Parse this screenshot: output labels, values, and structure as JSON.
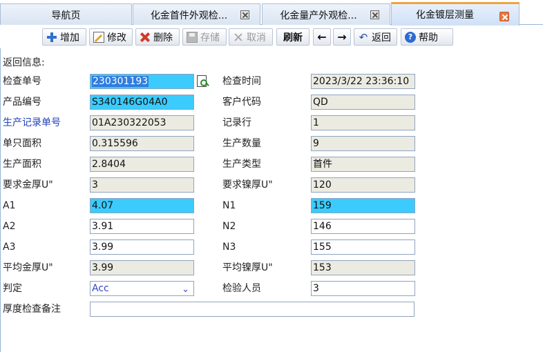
{
  "tabs": [
    {
      "label": "导航页"
    },
    {
      "label": "化金首件外观检..."
    },
    {
      "label": "化金量产外观检..."
    },
    {
      "label": "化金镀层测量"
    }
  ],
  "toolbar": {
    "add": "增加",
    "edit": "修改",
    "delete": "删除",
    "save": "存储",
    "cancel": "取消",
    "refresh": "刷新",
    "prev": "←",
    "next": "→",
    "back": "返回",
    "help": "帮助",
    "help_icon_glyph": "?",
    "back_icon_glyph": "↶"
  },
  "form": {
    "return_info_label": "返回信息:",
    "inspection_no": {
      "label": "检查单号",
      "value": "230301193"
    },
    "inspection_time": {
      "label": "检查时间",
      "value": "2023/3/22 23:36:10"
    },
    "product_no": {
      "label": "产品编号",
      "value": "S340146G04A0"
    },
    "customer_code": {
      "label": "客户代码",
      "value": "QD"
    },
    "production_record_no": {
      "label": "生产记录单号",
      "value": "01A230322053"
    },
    "record_row": {
      "label": "记录行",
      "value": "1"
    },
    "unit_area": {
      "label": "单只面积",
      "value": "0.315596"
    },
    "production_qty": {
      "label": "生产数量",
      "value": "9"
    },
    "production_area": {
      "label": "生产面积",
      "value": "2.8404"
    },
    "production_type": {
      "label": "生产类型",
      "value": "首件"
    },
    "req_gold": {
      "label": "要求金厚U\"",
      "value": "3"
    },
    "req_nickel": {
      "label": "要求镍厚U\"",
      "value": "120"
    },
    "a1": {
      "label": "A1",
      "value": "4.07"
    },
    "n1": {
      "label": "N1",
      "value": "159"
    },
    "a2": {
      "label": "A2",
      "value": "3.91"
    },
    "n2": {
      "label": "N2",
      "value": "146"
    },
    "a3": {
      "label": "A3",
      "value": "3.99"
    },
    "n3": {
      "label": "N3",
      "value": "155"
    },
    "avg_gold": {
      "label": "平均金厚U\"",
      "value": "3.99"
    },
    "avg_nickel": {
      "label": "平均镍厚U\"",
      "value": "153"
    },
    "judgement": {
      "label": "判定",
      "value": "Acc"
    },
    "inspector": {
      "label": "检验人员",
      "value": "3"
    },
    "thickness_note": {
      "label": "厚度检查备注",
      "value": ""
    }
  },
  "colors": {
    "highlight_field": "#3bcbfd",
    "readonly_field": "#ecebe2",
    "active_tab_accent": "#f0a23c",
    "link_label": "#1f3fb8"
  }
}
